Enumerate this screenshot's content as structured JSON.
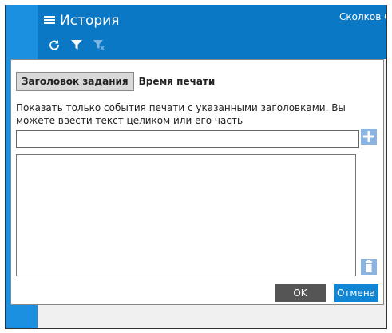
{
  "header": {
    "title": "История",
    "user": "Сколков С.К",
    "toolbar": {
      "refresh_icon": "refresh-icon",
      "filter_icon": "filter-icon",
      "clear_filter_icon": "clear-filter-icon"
    }
  },
  "dialog": {
    "tabs": [
      {
        "label": "Заголовок задания",
        "active": true
      },
      {
        "label": "Время печати",
        "active": false
      }
    ],
    "description": "Показать только события печати с указанными заголовками. Вы можете ввести текст целиком или его часть",
    "input": {
      "value": "",
      "placeholder": ""
    },
    "buttons": {
      "ok": "OK",
      "cancel": "Отмена"
    }
  },
  "colors": {
    "header": "#0b78c6",
    "leftbar": "#1b8fe0",
    "accent": "#1186d4",
    "muted_button": "#8bb4e0"
  }
}
